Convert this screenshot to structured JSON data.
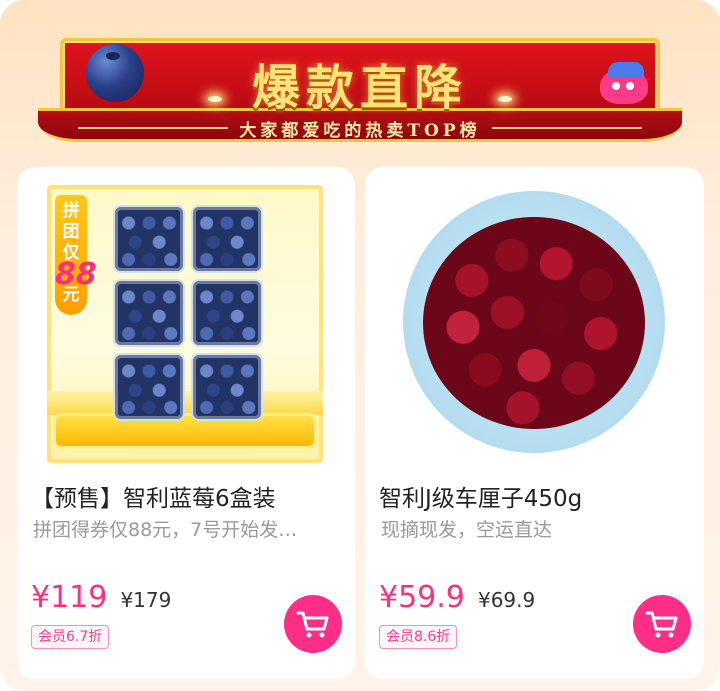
{
  "banner": {
    "title": "爆款直降",
    "subtitle": "大家都爱吃的热卖TOP榜"
  },
  "products": [
    {
      "promo_tag": [
        "拼",
        "团",
        "仅",
        "88",
        "元"
      ],
      "name": "【预售】智利蓝莓6盒装",
      "desc": "拼团得券仅88元，7号开始发…",
      "price": "¥119",
      "original_price": "¥179",
      "member_badge": "会员6.7折",
      "image_icon": "blueberry-box-image"
    },
    {
      "name": "智利J级车厘子450g",
      "desc": "现摘现发，空运直达",
      "price": "¥59.9",
      "original_price": "¥69.9",
      "member_badge": "会员8.6折",
      "image_icon": "cherry-plate-image"
    }
  ],
  "colors": {
    "accent_pink": "#ff2f88",
    "price_pink": "#ff2f7e",
    "banner_red": "#d0101a",
    "banner_gold": "#ffe27a"
  },
  "icons": {
    "cart": "shopping-cart-icon"
  }
}
